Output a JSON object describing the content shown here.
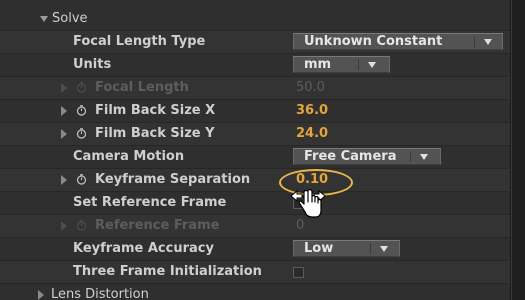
{
  "section": {
    "label": "Solve"
  },
  "rows": {
    "focal_length_type": {
      "label": "Focal Length Type",
      "value": "Unknown Constant"
    },
    "units": {
      "label": "Units",
      "value": "mm"
    },
    "focal_length": {
      "label": "Focal Length",
      "value": "50.0"
    },
    "film_back_x": {
      "label": "Film Back Size X",
      "value": "36.0"
    },
    "film_back_y": {
      "label": "Film Back Size Y",
      "value": "24.0"
    },
    "camera_motion": {
      "label": "Camera Motion",
      "value": "Free Camera"
    },
    "keyframe_separation": {
      "label": "Keyframe Separation",
      "value": "0.10"
    },
    "set_reference_frame": {
      "label": "Set Reference Frame",
      "checked": false
    },
    "reference_frame": {
      "label": "Reference Frame",
      "value": "0"
    },
    "keyframe_accuracy": {
      "label": "Keyframe Accuracy",
      "value": "Low"
    },
    "three_frame_init": {
      "label": "Three Frame Initialization",
      "checked": false
    }
  },
  "next_section": {
    "label": "Lens Distortion"
  },
  "icons": {
    "expand": "triangle-right-icon",
    "collapse": "triangle-down-icon",
    "stopwatch": "stopwatch-icon",
    "cursor": "hand-scrub-cursor-icon"
  },
  "colors": {
    "panel_bg": "#2f2f2f",
    "label": "#cfcfcf",
    "disabled": "#5d5d5d",
    "value_accent": "#e4a53a",
    "highlight": "#e8b64a"
  }
}
